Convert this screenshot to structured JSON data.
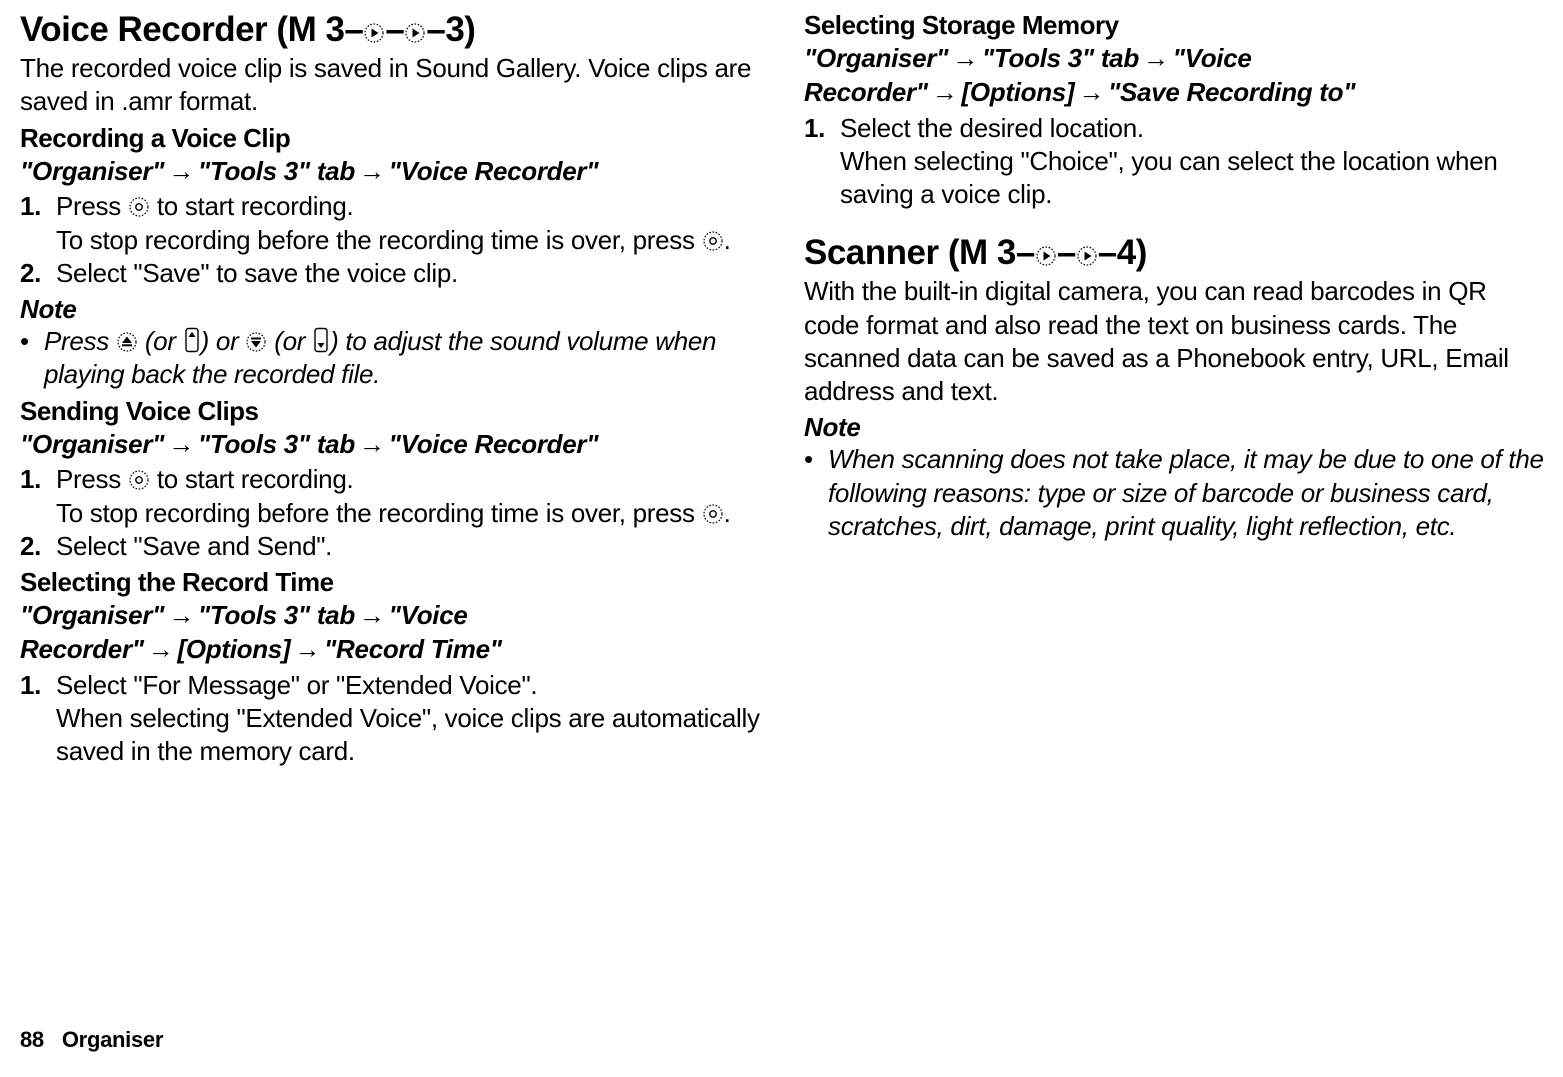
{
  "left": {
    "title_pre": "Voice Recorder",
    "title_code_pre": " (M 3–",
    "title_code_mid": "–",
    "title_code_post": "–3)",
    "intro": "The recorded voice clip is saved in Sound Gallery. Voice clips are saved in .amr format.",
    "recording": {
      "heading": "Recording a Voice Clip",
      "path1": "\"Organiser\"",
      "path2": "\"Tools 3\" tab",
      "path3": "\"Voice Recorder\"",
      "step1a": "Press ",
      "step1b": " to start recording.",
      "step1c": "To stop recording before the recording time is over, press ",
      "step1d": ".",
      "step2": "Select \"Save\" to save the voice clip."
    },
    "note1": {
      "label": "Note",
      "a": "Press ",
      "b": " (or ",
      "c": ") or ",
      "d": " (or ",
      "e": ") to adjust the sound volume when playing back the recorded file."
    },
    "sending": {
      "heading": "Sending Voice Clips",
      "path1": "\"Organiser\"",
      "path2": "\"Tools 3\" tab",
      "path3": "\"Voice Recorder\"",
      "step1a": "Press ",
      "step1b": " to start recording.",
      "step1c": "To stop recording before the recording time is over, press ",
      "step1d": ".",
      "step2": "Select \"Save and Send\"."
    },
    "recordtime": {
      "heading": "Selecting the Record Time",
      "path1": "\"Organiser\"",
      "path2": "\"Tools 3\" tab",
      "path3": "\"Voice Recorder\"",
      "path4": "[Options]",
      "path5": "\"Record Time\"",
      "step1": "Select \"For Message\" or \"Extended Voice\".",
      "step1sub": "When selecting \"Extended Voice\", voice clips are automatically saved in the memory card."
    }
  },
  "right": {
    "storage": {
      "heading": "Selecting Storage Memory",
      "path1": "\"Organiser\"",
      "path2": "\"Tools 3\" tab",
      "path3": "\"Voice Recorder\"",
      "path4": "[Options]",
      "path5": "\"Save Recording to\"",
      "step1": "Select the desired location.",
      "step1sub": "When selecting \"Choice\", you can select the location when saving a voice clip."
    },
    "scanner": {
      "title_pre": "Scanner",
      "title_code_pre": " (M 3–",
      "title_code_mid": "–",
      "title_code_post": "–4)",
      "intro": "With the built-in digital camera, you can read barcodes in QR code format and also read the text on business cards. The scanned data can be saved as a Phonebook entry, URL, Email address and text.",
      "notelabel": "Note",
      "notetext": "When scanning does not take place, it may be due to one of the following reasons: type or size of barcode or business card, scratches, dirt, damage, print quality, light reflection, etc."
    }
  },
  "footer": {
    "page": "88",
    "section": "Organiser"
  },
  "arrow": "→"
}
